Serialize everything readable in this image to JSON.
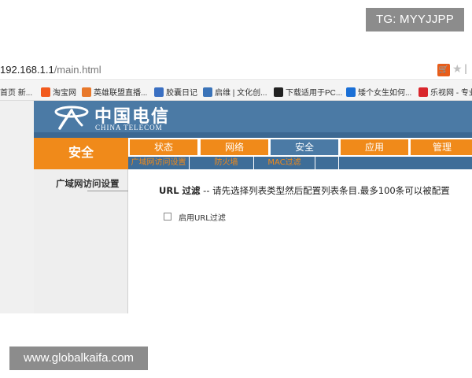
{
  "watermarks": {
    "top": "TG: MYYJJPP",
    "bottom": "www.globalkaifa.com"
  },
  "browser": {
    "address": {
      "host": "192.168.1.1",
      "path": "/main.html"
    },
    "bookmarks": [
      {
        "label": "首页 新...",
        "icon": "page-icon",
        "color": "#dddddd"
      },
      {
        "label": "淘宝网",
        "icon": "taobao-icon",
        "color": "#f25a1d"
      },
      {
        "label": "英雄联盟直播...",
        "icon": "flower-icon",
        "color": "#e8782a"
      },
      {
        "label": "胶囊日记",
        "icon": "capsule-icon",
        "color": "#3a6fc2"
      },
      {
        "label": "启维 | 文化创...",
        "icon": "ring-icon",
        "color": "#3a73b8"
      },
      {
        "label": "下载适用于PC...",
        "icon": "s-icon",
        "color": "#222222"
      },
      {
        "label": "矮个女生如何...",
        "icon": "zhihu-icon",
        "color": "#1a6fd6"
      },
      {
        "label": "乐视网 - 专业...",
        "icon": "letv-icon",
        "color": "#d9262c"
      }
    ]
  },
  "router": {
    "brand_cn": "中国电信",
    "brand_en": "CHINA TELECOM",
    "section_title": "安全",
    "nav_tabs": [
      {
        "label": "状态",
        "active": false
      },
      {
        "label": "网络",
        "active": false
      },
      {
        "label": "安全",
        "active": true
      },
      {
        "label": "应用",
        "active": false
      },
      {
        "label": "管理",
        "active": false
      }
    ],
    "sub_tabs": [
      "广域网访问设置",
      "防火墙",
      "MAC过滤"
    ],
    "sidebar_item": "广域网访问设置",
    "main": {
      "title_prefix": "URL 过滤",
      "title_text": " -- 请先选择列表类型然后配置列表条目.最多100条可以被配置",
      "checkbox_label": "启用URL过滤",
      "checkbox_checked": false
    }
  }
}
